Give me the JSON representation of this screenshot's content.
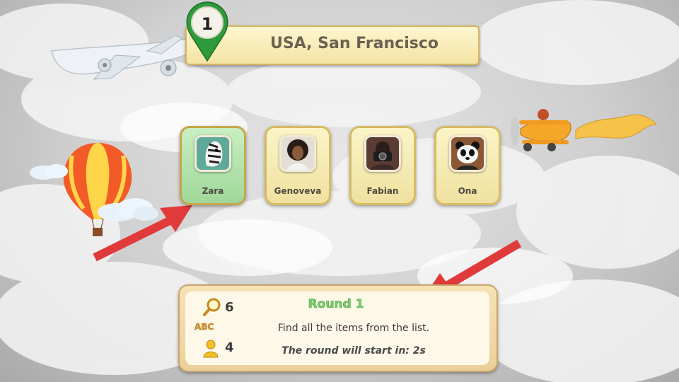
{
  "location": {
    "level": "1",
    "title": "USA, San Francisco"
  },
  "characters": [
    {
      "name": "Zara",
      "selected": true,
      "icon": "zebra-portrait"
    },
    {
      "name": "Genoveva",
      "selected": false,
      "icon": "woman-portrait"
    },
    {
      "name": "Fabian",
      "selected": false,
      "icon": "photographer-portrait"
    },
    {
      "name": "Ona",
      "selected": false,
      "icon": "panda-portrait"
    }
  ],
  "info": {
    "round_title": "Round 1",
    "instruction": "Find all the items from the list.",
    "countdown": "The round will start in: 2s",
    "hint_count": "6",
    "abc_label": "ABC",
    "players_count": "4"
  },
  "colors": {
    "accent_green": "#7ad06c",
    "arrow_red": "#e03a3a",
    "card_gold": "#d7bb64"
  }
}
